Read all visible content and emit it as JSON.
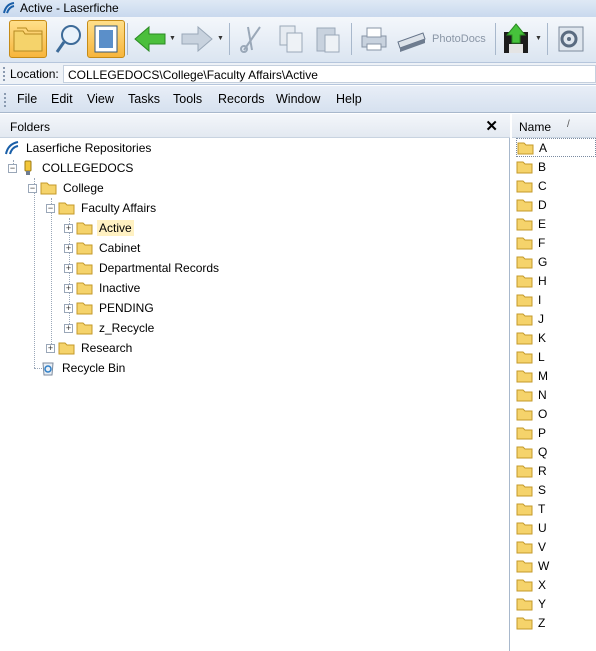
{
  "window": {
    "title": "Active - Laserfiche"
  },
  "toolbar": {
    "items": [
      {
        "name": "folders-view-button",
        "icon": "folders-icon"
      },
      {
        "name": "search-button",
        "icon": "magnifier-icon"
      },
      {
        "name": "metadata-button",
        "icon": "document-panel-icon"
      },
      {
        "name": "back-button",
        "icon": "arrow-left-icon"
      },
      {
        "name": "forward-button",
        "icon": "arrow-right-icon"
      },
      {
        "name": "cut-button",
        "icon": "scissors-icon"
      },
      {
        "name": "copy-button",
        "icon": "copy-icon"
      },
      {
        "name": "paste-button",
        "icon": "paste-icon"
      },
      {
        "name": "print-button",
        "icon": "printer-icon"
      },
      {
        "name": "scan-button",
        "icon": "scanner-icon"
      },
      {
        "name": "export-button",
        "icon": "export-icon"
      },
      {
        "name": "settings-button",
        "icon": "gear-icon"
      }
    ],
    "photodocs_label": "PhotoDocs"
  },
  "location": {
    "label": "Location:",
    "path": "COLLEGEDOCS\\College\\Faculty Affairs\\Active"
  },
  "menu": [
    "File",
    "Edit",
    "View",
    "Tasks",
    "Tools",
    "Records",
    "Window",
    "Help"
  ],
  "folders_pane": {
    "title": "Folders",
    "close_label": "✕",
    "tree": {
      "root": "Laserfiche Repositories",
      "repository": "COLLEGEDOCS",
      "college": "College",
      "faculty_affairs": "Faculty Affairs",
      "children": [
        "Active",
        "Cabinet",
        "Departmental Records",
        "Inactive",
        "PENDING",
        "z_Recycle"
      ],
      "research": "Research",
      "recycle_bin": "Recycle Bin",
      "selected": "Active"
    }
  },
  "contents_pane": {
    "column_name": "Name",
    "sort_indicator": "/",
    "items": [
      "A",
      "B",
      "C",
      "D",
      "E",
      "F",
      "G",
      "H",
      "I",
      "J",
      "K",
      "L",
      "M",
      "N",
      "O",
      "P",
      "Q",
      "R",
      "S",
      "T",
      "U",
      "V",
      "W",
      "X",
      "Y",
      "Z"
    ]
  },
  "colors": {
    "folder_fill": "#f5d36b",
    "folder_stroke": "#c49a2a",
    "active_tool": "#f7b53c",
    "menubar": "#d6e1ef",
    "selection": "#fff1c2"
  }
}
